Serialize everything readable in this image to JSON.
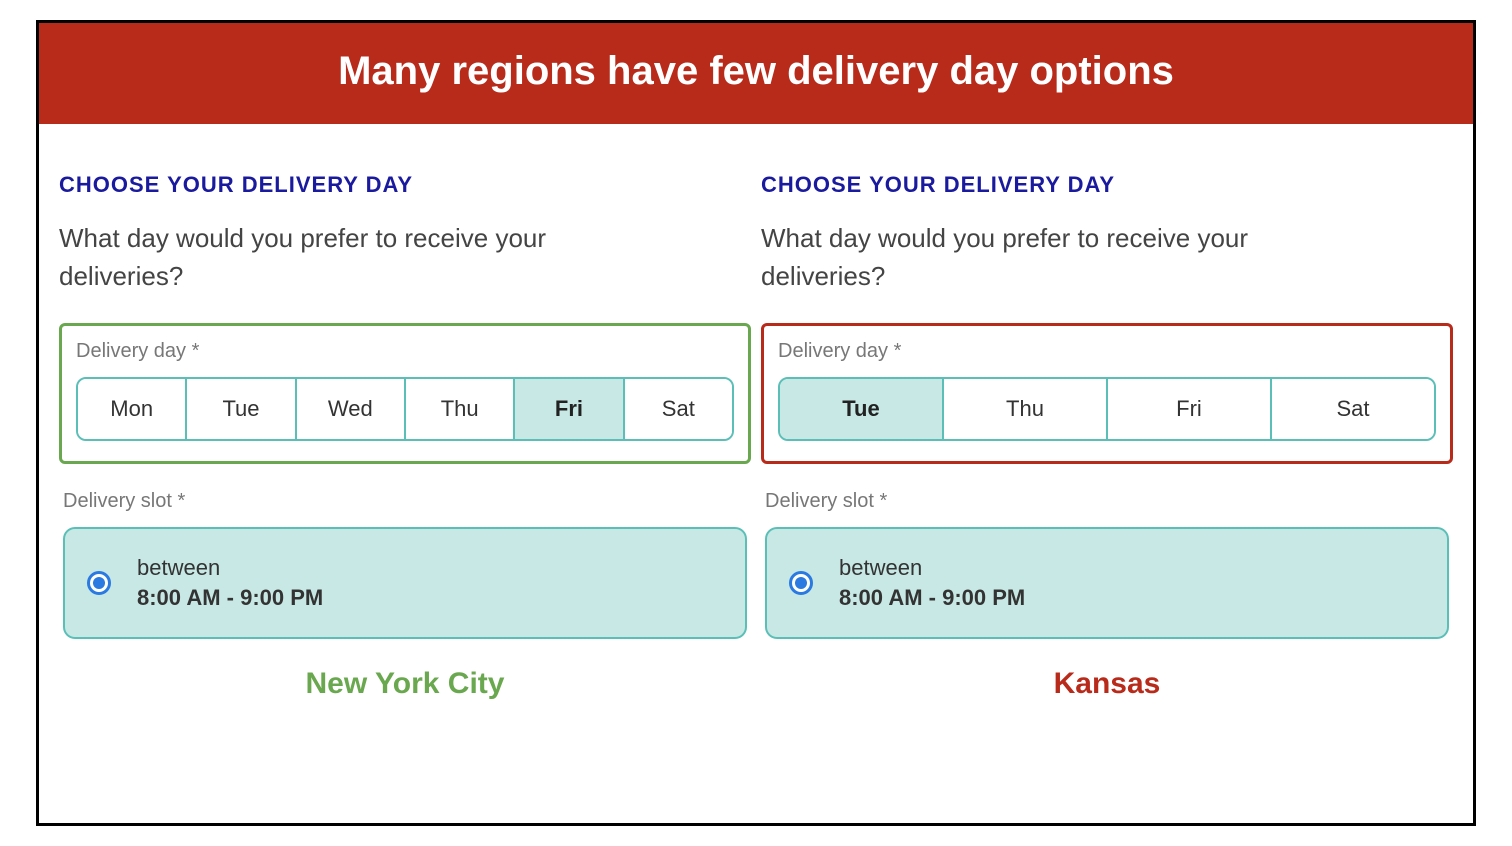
{
  "banner_title": "Many regions have few delivery day options",
  "section_title": "CHOOSE YOUR DELIVERY DAY",
  "prompt_text": "What day would you prefer to receive your deliveries?",
  "field_delivery_day_label": "Delivery day *",
  "field_delivery_slot_label": "Delivery slot *",
  "slot_between_word": "between",
  "slot_time_range": "8:00 AM - 9:00 PM",
  "left": {
    "days": [
      "Mon",
      "Tue",
      "Wed",
      "Thu",
      "Fri",
      "Sat"
    ],
    "selected_day": "Fri",
    "city_label": "New York City"
  },
  "right": {
    "days": [
      "Tue",
      "Thu",
      "Fri",
      "Sat"
    ],
    "selected_day": "Tue",
    "city_label": "Kansas"
  },
  "colors": {
    "banner_bg": "#b82a1a",
    "accent_teal": "#5bbfb8",
    "highlight_green": "#6aa84f",
    "highlight_red": "#b82a1a",
    "radio_blue": "#2a7ae2"
  }
}
